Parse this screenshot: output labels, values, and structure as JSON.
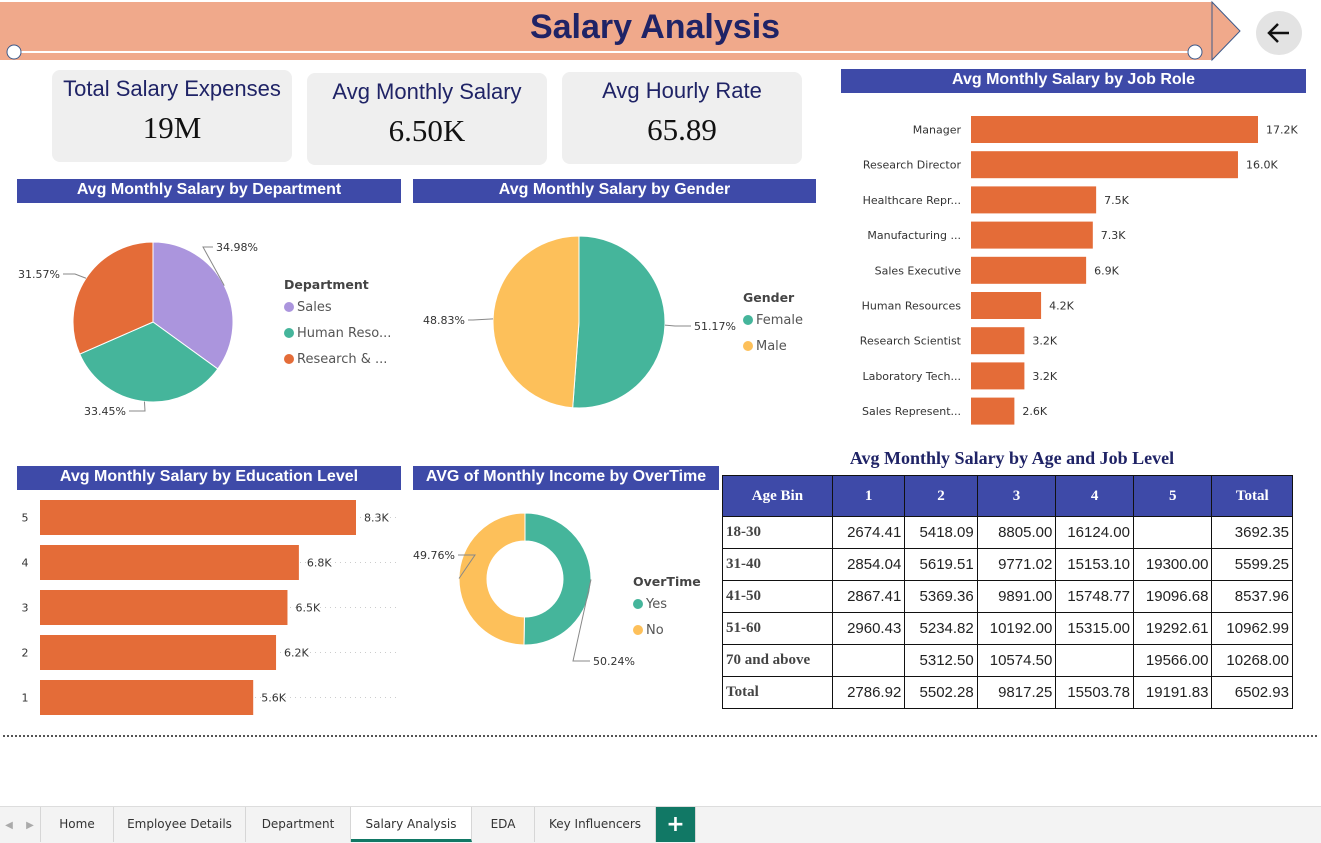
{
  "page_title": "Salary Analysis",
  "colors": {
    "header_bg": "#3e4aa8",
    "title": "#1f2366",
    "banner": "#f0a98b",
    "bar": "#e46c38",
    "teal": "#45b59b",
    "purple": "#ab95dd",
    "yellow": "#fdc05a"
  },
  "kpis": [
    {
      "label": "Total Salary Expenses",
      "value": "19M"
    },
    {
      "label": "Avg Monthly Salary",
      "value": "6.50K"
    },
    {
      "label": "Avg Hourly Rate",
      "value": "65.89"
    }
  ],
  "icons": {
    "back": "arrow-left-icon",
    "add": "plus-icon",
    "prev": "chevron-left-icon",
    "next": "chevron-right-icon"
  },
  "chart_data": [
    {
      "id": "dept",
      "type": "pie",
      "title": "Avg Monthly Salary by Department",
      "legend_title": "Department",
      "slices": [
        {
          "name": "Sales",
          "value": 34.98,
          "label": "34.98%",
          "color": "#ab95dd"
        },
        {
          "name": "Human Reso...",
          "value": 33.45,
          "label": "33.45%",
          "color": "#45b59b"
        },
        {
          "name": "Research & ...",
          "value": 31.57,
          "label": "31.57%",
          "color": "#e46c38"
        }
      ]
    },
    {
      "id": "gender",
      "type": "pie",
      "title": "Avg Monthly Salary by Gender",
      "legend_title": "Gender",
      "slices": [
        {
          "name": "Female",
          "value": 51.17,
          "label": "51.17%",
          "color": "#45b59b"
        },
        {
          "name": "Male",
          "value": 48.83,
          "label": "48.83%",
          "color": "#fdc05a"
        }
      ]
    },
    {
      "id": "jobrole",
      "type": "bar",
      "orientation": "horizontal",
      "title": "Avg Monthly Salary by Job Role",
      "categories": [
        "Manager",
        "Research Director",
        "Healthcare Repr...",
        "Manufacturing ...",
        "Sales Executive",
        "Human Resources",
        "Research Scientist",
        "Laboratory Tech...",
        "Sales Represent..."
      ],
      "values": [
        17.2,
        16.0,
        7.5,
        7.3,
        6.9,
        4.2,
        3.2,
        3.2,
        2.6
      ],
      "labels": [
        "17.2K",
        "16.0K",
        "7.5K",
        "7.3K",
        "6.9K",
        "4.2K",
        "3.2K",
        "3.2K",
        "2.6K"
      ],
      "unit": "K"
    },
    {
      "id": "education",
      "type": "bar",
      "orientation": "horizontal",
      "title": "Avg Monthly Salary by Education Level",
      "categories": [
        "5",
        "4",
        "3",
        "2",
        "1"
      ],
      "values": [
        8.3,
        6.8,
        6.5,
        6.2,
        5.6
      ],
      "labels": [
        "8.3K",
        "6.8K",
        "6.5K",
        "6.2K",
        "5.6K"
      ],
      "unit": "K"
    },
    {
      "id": "overtime",
      "type": "pie",
      "donut": true,
      "title": "AVG of Monthly Income by OverTime",
      "legend_title": "OverTime",
      "slices": [
        {
          "name": "Yes",
          "value": 50.24,
          "label": "50.24%",
          "color": "#45b59b"
        },
        {
          "name": "No",
          "value": 49.76,
          "label": "49.76%",
          "color": "#fdc05a"
        }
      ]
    },
    {
      "id": "agelevel",
      "type": "table",
      "title": "Avg Monthly Salary by Age and Job Level",
      "columns": [
        "Age Bin",
        "1",
        "2",
        "3",
        "4",
        "5",
        "Total"
      ],
      "rows": [
        [
          "18-30",
          "2674.41",
          "5418.09",
          "8805.00",
          "16124.00",
          "",
          "3692.35"
        ],
        [
          "31-40",
          "2854.04",
          "5619.51",
          "9771.02",
          "15153.10",
          "19300.00",
          "5599.25"
        ],
        [
          "41-50",
          "2867.41",
          "5369.36",
          "9891.00",
          "15748.77",
          "19096.68",
          "8537.96"
        ],
        [
          "51-60",
          "2960.43",
          "5234.82",
          "10192.00",
          "15315.00",
          "19292.61",
          "10962.99"
        ],
        [
          "70 and above",
          "",
          "5312.50",
          "10574.50",
          "",
          "19566.00",
          "10268.00"
        ],
        [
          "Total",
          "2786.92",
          "5502.28",
          "9817.25",
          "15503.78",
          "19191.83",
          "6502.93"
        ]
      ]
    }
  ],
  "tabs": [
    {
      "label": "Home",
      "active": false
    },
    {
      "label": "Employee Details",
      "active": false
    },
    {
      "label": "Department",
      "active": false
    },
    {
      "label": "Salary Analysis",
      "active": true
    },
    {
      "label": "EDA",
      "active": false
    },
    {
      "label": "Key Influencers",
      "active": false
    }
  ]
}
